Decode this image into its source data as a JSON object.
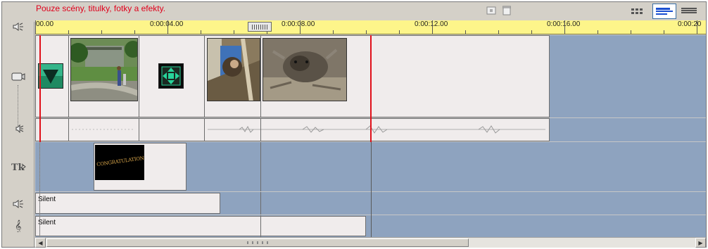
{
  "storyboard": {
    "status_message": "Pouze scény, titulky, fotky a efekty.",
    "ruler": {
      "labels": [
        "00.00",
        "0:00:04.00",
        "0:00:08.00",
        "0:00:12.00",
        "0:00:16.00",
        "0:00:20"
      ]
    },
    "title_overlay_text": "CONGRATULATIONS!",
    "audio_tracks": [
      {
        "label": "Silent"
      },
      {
        "label": "Silent"
      }
    ]
  },
  "colors": {
    "message_red": "#e0001b",
    "ruler_yellow": "#fdf58a",
    "timeline_blue": "#8ea3bf",
    "playhead_red": "#e0101a",
    "clip_bg": "#f0ecec"
  }
}
